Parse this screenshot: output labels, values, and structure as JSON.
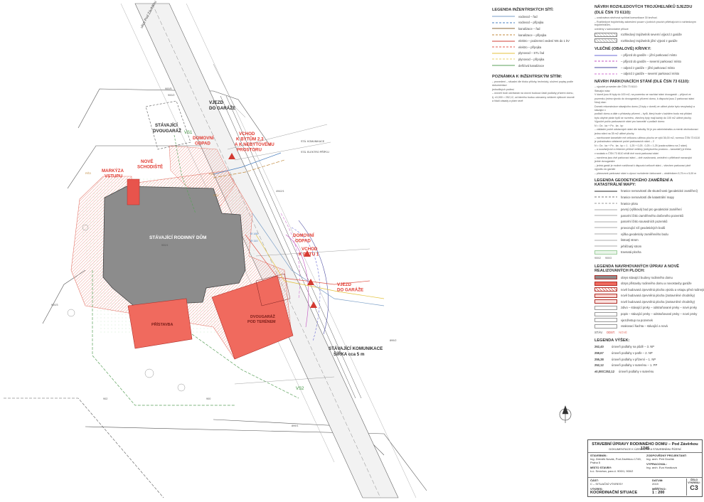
{
  "plan": {
    "labels": {
      "garage_existing": [
        "STÁVAJÍCÍ",
        "DVOUGARÁŽ"
      ],
      "garage_entry_top": [
        "VJEZD",
        "DO GARÁŽE"
      ],
      "entry_flats": [
        "VCHOD",
        "K BYTŮM 2,3",
        "A K NEBYTOVÉMU",
        "PROSTORU"
      ],
      "waste_top": [
        "DOMOVNÍ",
        "ODPAD"
      ],
      "new_stairs": [
        "NOVÉ",
        "SCHODIŠTĚ"
      ],
      "canopy": [
        "MARKÝZA",
        "VSTUPU"
      ],
      "house": "STÁVAJÍCÍ RODINNÝ DŮM",
      "waste_bottom": [
        "DOMOVNÍ",
        "ODPAD"
      ],
      "entry_flat1": [
        "VCHOD",
        "K BYTU 1"
      ],
      "garage_entry_bottom": [
        "VJEZD",
        "DO GARÁŽE"
      ],
      "extension": "PŘÍSTAVBA",
      "garage_underground": [
        "DVOUGARÁŽ",
        "POD TERÉNEM"
      ],
      "road": [
        "STÁVAJÍCÍ KOMUNIKACE",
        "ŠÍŘKA cca 5 m"
      ],
      "street": "ulice Pod Závěrkou",
      "sewer_label": "STÁ. KOMUNIKACE",
      "water_label": "STÁ. ELEKTRO PŘÍPOJ",
      "vs1": "VS1",
      "vs2": "VS2",
      "parcel_numbers": [
        "900/5",
        "900/2",
        "900/1",
        "4942/1",
        "900/3",
        "902",
        "900",
        "899/1",
        "899/2"
      ],
      "details": [
        "RŠ3",
        "RŠ2",
        "RŠ1",
        "Ø 160",
        "Ø 110"
      ]
    }
  },
  "legend": {
    "networks": {
      "title": "LEGENDA INŽENÝRSKÝCH SÍTÍ:",
      "items": [
        {
          "label": "vodovod – řad",
          "color": "#7a9ec7"
        },
        {
          "label": "vodovod – přípojka",
          "color": "#4a7fbf"
        },
        {
          "label": "kanalizace – řad",
          "color": "#8a6a3a"
        },
        {
          "label": "kanalizace – přípojka",
          "color": "#c08a3e"
        },
        {
          "label": "elektro – podzemní vedení NN do 1 kV",
          "color": "#d0403a"
        },
        {
          "label": "elektro – přípojka",
          "color": "#e05a4e"
        },
        {
          "label": "plynovod – STL řad",
          "color": "#e3c23c"
        },
        {
          "label": "plynovod – přípojka",
          "color": "#e8d06a"
        },
        {
          "label": "dešťová kanalizace",
          "color": "#5aa05a"
        }
      ]
    },
    "note_networks": {
      "title": "POZNÁMKA K INŽENÝRSKÝM SÍTÍM:",
      "lines": [
        "– provedení – situační dle bloku přílohy, technický, uložení popisy podle dokumentací",
        "  jednotlivých profesí",
        "– úroveň bodí odvrtanán na úrovni budoucí části podlahy přízemí domu,",
        "  tj. ±0,000 = 252,12, od kterého budou odvozeny veškeré výškové úrovně",
        "  a hladí zásady a plám sevě"
      ]
    },
    "turn": {
      "title": "NÁVRH ROZHLEDOVÝCH TROJÚHELNÍKŮ SJEZDU",
      "subtitle": "(dle ČSN 73 6110):",
      "lines": [
        "– uvažována návrhová rychlost komunikace 30 km/hod.",
        "– Rozhledové trojúhelníky zakreslení pouze v jízdních pruzích přiléhajících k rozhledovým trojúhelníkům,",
        "  uvedeny v samostatné příloze"
      ],
      "items": [
        "rozhledový trojúhelník severní výjezd z garáže",
        "rozhledový trojúhelník jižní výjezd z garáže"
      ]
    },
    "curves": {
      "title": "VLEČNÉ (OBALOVÉ) KŘIVKY:",
      "items": [
        {
          "label": "– příjezd do garáže – jižní parkovací místo",
          "color": "#6a6ad6"
        },
        {
          "label": "– příjezd do garáže – severní parkovací místo",
          "color": "#c050c0"
        },
        {
          "label": "– odjezd z garáže – jižní parkovací místo",
          "color": "#4a4aa0"
        },
        {
          "label": "– odjezd z garáže – severní parkovací místo",
          "color": "#d070d0"
        }
      ]
    },
    "parking": {
      "title": "NÁVRH PARKOVACÍCH STÁNÍ (dle ČSN 73 6110):",
      "lines": [
        "– výpočet proveden dle ČSN 73 6110:",
        "Stávající stav:",
        "V domě jsou tři byty do 100 m2, na pozemku se nachází stání dvougaráž – příjezd ve",
        "pozemku (mimo vjezdu do dvougaráže) přízemí domu, k dispozici jsou 2 parkovací stání",
        "Nový stav:",
        "Domek rekonstrukce stávajícího domu (3 byty v domě) ve užitné ploše bytu nevyžadují a stávající v",
        "podlaží domu a dále o přístavby přízemí – bytů, který bude v každém bodu má přídání",
        "bytu obytné ploše bytů se rozměru, všechny byty mají každý do 100 m2 užitné plochy.",
        "Výpočet počtu parkovacích stání pro kancelář v podlaží domu:",
        "N = Oo . ka + Po . ka . kp",
        "– základní počet odstavných stání dle tabulky 34 je pro administrativu a menší obchodovací",
        "  jedno stání na 35 m2 užitné plochy",
        "– navrhované kanceláře mě celkovou užitnou plochu ve výši 36,00 m2, normou ČSN 73 6110",
        "  je požadováno odstavné počet parkovacích stání – 2",
        "N = Oo . ka + Po . ka . kp = 1 . 1,25 + 0,25 . 0,25 = 1,25 (zaokrouhleno na 2 stání)",
        "– a souvisejících s řešením příčiné veličiny (nebytového prostoru – kanceláří) je třeba",
        "  v souladu s ČSN 73 6110 zřídit dvě nová parkovací stání",
        "– navržena jsou dvě parkovací stání – obě uvažovaná, umístění v přiléhavě navazující",
        "  jedné dvougaráže",
        "– jedná garáž je možné rozšiřovat k dispozici celkově stání – všechen parkovací plně",
        "  výpočtu do garáže",
        "– plánované parkovací stání s výcucí rozloženie čárkované – obdélníkem 5,75 m x 5,00 m"
      ]
    },
    "survey": {
      "title": "LEGENDA GEODETICKÉHO ZAMĚŘENÍ A KATASTRÁLNÍ MAPY:",
      "items": [
        "hranice nemovitostí dle skutečnosti (geodetické zaměření)",
        "hranice nemovitostí dle katastrální mapy",
        "hranice plotu",
        "pevný (výšková) bod pro geodetické zaměření",
        "parcelní číslo zaměřeného dotčeného pozemků",
        "parcelní číslo sousedních pozemků",
        "provozující síť geodetických bodů",
        "výška geodeticky zaměřeného bodu",
        "listnatý strom",
        "jehličnatý strom",
        "travnatá plocha"
      ],
      "marks": [
        "900/2",
        "900/3"
      ]
    },
    "proposed": {
      "title": "LEGENDA navrhovaných úprav a nově realizovaných ploch:",
      "items": [
        "obrys stávající budovy rodinného domu",
        "obrys přístavby rodinného domu a novostavby garáže",
        "nově budovaná zpevněná plocha vjezdu a vstupu před rodinným domem",
        "nově budovaná zpevněná plocha (zatravněné chodníky)",
        "nově budovaná zpevněná plocha (zatravněné chodníky)",
        "zdivo – stávající prvky – odstraňované prvky – nové prvky",
        "popis – stávající prvky – odstraňované prvky – nové prvky",
        "vjezd/vstup na pozemek",
        "vsakovací šachta – stávající a nová"
      ],
      "status_words": [
        "STÁV.",
        "ODST.",
        "NOVÉ"
      ]
    },
    "heights": {
      "title": "LEGENDA VÝŠEK:",
      "items": [
        {
          "value": "262,40",
          "label": "úroveň podlahy na půdě – 3. NP"
        },
        {
          "value": "259,67",
          "label": "úroveň podlahy v patře – 2. NP"
        },
        {
          "value": "255,38",
          "label": "úroveň podlahy v přízemí – 1. NP"
        },
        {
          "value": "252,12",
          "label": "úroveň podlahy v suterénu – 1. PP"
        }
      ],
      "zero": {
        "value": "±0,000=252,12",
        "label": "úroveň podlahy v suterénu"
      }
    }
  },
  "titleblock": {
    "title": "STAVEBNÍ ÚPRAVY RODINNÉHO DOMU – Pod Závěrkou 1745",
    "subtitle": "DOKUMENTACE K ÚZEMNÍMU A STAVEBNÍMU ŘÍZENÍ",
    "investor_label": "STAVEBNÍK:",
    "investor": "Ing. Zdeněk Novák, Pod Závěrkou 1745, Praha 5",
    "place_label": "MÍSTO STAVBY:",
    "place": "k.ú. Smíchov, parc.č. 900/1, 900/2",
    "designer_label": "ZODPOVĚDNÝ PROJEKTANT:",
    "designer": "Ing. arch. Petr Dvořák",
    "drawn_label": "VYPRACOVAL:",
    "drawn": "Ing. arch. Eva Horáková",
    "part_label": "ČÁST:",
    "part": "C – SITUAČNÍ VÝKRESY",
    "drawing_label": "VÝKRES:",
    "drawing": "KOORDINAČNÍ SITUACE",
    "date_label": "DATUM:",
    "date": "2019",
    "scale_label": "MĚŘÍTKO:",
    "scale": "1 : 200",
    "no_label": "ČÍSLO VÝKRESU:",
    "no": "C3"
  }
}
